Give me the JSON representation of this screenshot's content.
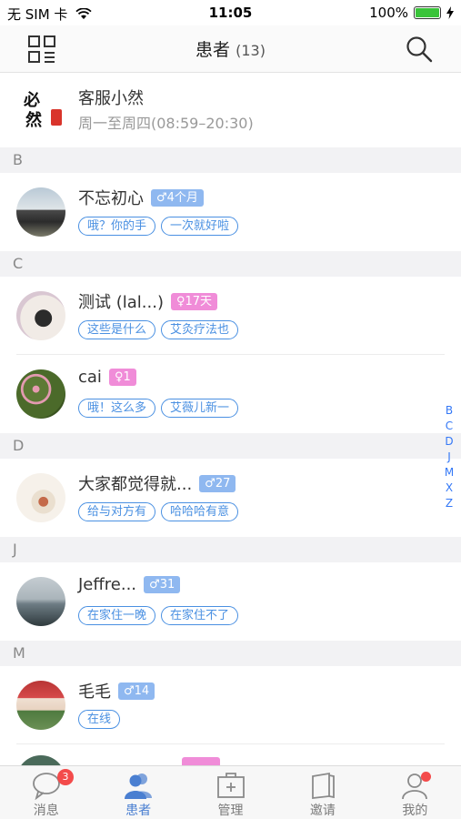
{
  "status_bar": {
    "carrier": "无 SIM 卡",
    "time": "11:05",
    "battery": "100%"
  },
  "header": {
    "title": "患者",
    "count": "(13)"
  },
  "service": {
    "name": "客服小然",
    "hours": "周一至周四(08:59–20:30)",
    "logo_text": "必然"
  },
  "sections": [
    {
      "letter": "B",
      "patients": [
        {
          "name": "不忘初心",
          "gender": "♂",
          "age": "4个月",
          "tags": [
            "哦？你的手",
            "一次就好啦"
          ]
        }
      ]
    },
    {
      "letter": "C",
      "patients": [
        {
          "name": "测试 (lal...)",
          "gender": "♀",
          "age": "17天",
          "tags": [
            "这些是什么",
            "艾灸疗法也"
          ]
        },
        {
          "name": "cai",
          "gender": "♀",
          "age": "1",
          "tags": [
            "哦！这么多",
            "艾薇儿新一"
          ]
        }
      ]
    },
    {
      "letter": "D",
      "patients": [
        {
          "name": "大家都觉得就...",
          "gender": "♂",
          "age": "27",
          "tags": [
            "给与对方有",
            "哈哈哈有意"
          ]
        }
      ]
    },
    {
      "letter": "J",
      "patients": [
        {
          "name": "Jeffre...",
          "gender": "♂",
          "age": "31",
          "tags": [
            "在家住一晚",
            "在家住不了"
          ]
        }
      ]
    },
    {
      "letter": "M",
      "patients": [
        {
          "name": "毛毛",
          "gender": "♂",
          "age": "14",
          "tags": [
            "在线"
          ]
        }
      ]
    }
  ],
  "index_letters": [
    "B",
    "C",
    "D",
    "J",
    "M",
    "X",
    "Z"
  ],
  "tabs": [
    {
      "label": "消息",
      "icon": "chat-bubble-icon",
      "badge": "3"
    },
    {
      "label": "患者",
      "icon": "patients-icon"
    },
    {
      "label": "管理",
      "icon": "medical-case-icon"
    },
    {
      "label": "邀请",
      "icon": "invite-book-icon"
    },
    {
      "label": "我的",
      "icon": "profile-icon"
    }
  ],
  "colors": {
    "accent": "#4a90e2",
    "male": "#8fb8f0",
    "female": "#f08cd8",
    "badge_red": "#f34b4b"
  }
}
